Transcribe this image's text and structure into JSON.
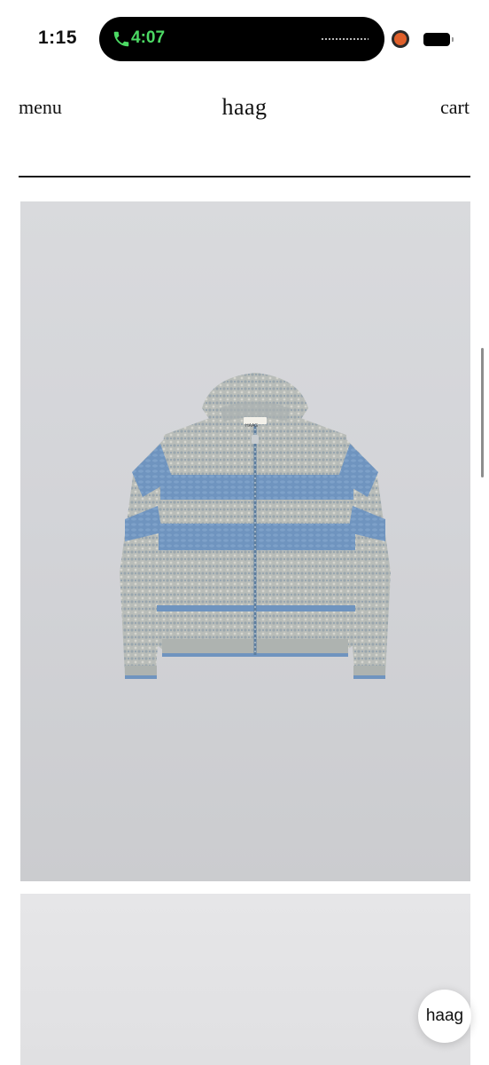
{
  "status_bar": {
    "time": "1:15",
    "call_timer": "4:07",
    "call_icon": "phone-icon",
    "battery_icon": "battery-icon",
    "accent_call_color": "#4cd964",
    "record_dot_color": "#e0602b"
  },
  "header": {
    "menu_label": "menu",
    "logo": "haag",
    "cart_label": "cart"
  },
  "products": [
    {
      "image": "knit zip cardigan, grey melange with blue stripes",
      "tag_text": "HAAG"
    },
    {
      "image": "product image"
    }
  ],
  "chat_button": {
    "label": "haag"
  },
  "colors": {
    "text": "#111111",
    "image_background": "#d3d4d8",
    "sweater_blue": "#6f94bf",
    "sweater_grey": "#b8bcb8"
  }
}
